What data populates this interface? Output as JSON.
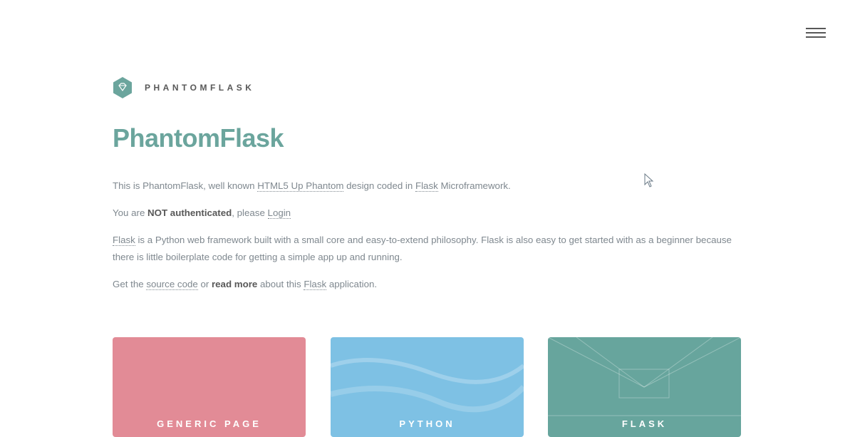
{
  "header": {
    "menu_icon": "hamburger-menu-icon"
  },
  "logo": {
    "icon": "gem-hexagon-icon",
    "text": "PHANTOMFLASK",
    "color": "#6ba59d"
  },
  "main": {
    "title": "PhantomFlask",
    "intro": {
      "t1": "This is PhantomFlask, well known ",
      "link1": "HTML5 Up Phantom",
      "t2": " design coded in ",
      "link2": "Flask",
      "t3": " Microframework."
    },
    "auth": {
      "t1": "You are ",
      "strong": "NOT authenticated",
      "t2": ", please ",
      "link": "Login"
    },
    "flask_desc": {
      "link": "Flask",
      "t1": " is a Python web framework built with a small core and easy-to-extend philosophy. Flask is also easy to get started with as a beginner because there is little boilerplate code for getting a simple app up and running."
    },
    "source": {
      "t1": "Get the ",
      "link1": "source code",
      "t2": " or ",
      "link2": "read more",
      "t3": " about this ",
      "link3": "Flask",
      "t4": " application."
    }
  },
  "tiles": [
    {
      "label": "GENERIC PAGE",
      "color": "#e28b96"
    },
    {
      "label": "PYTHON",
      "color": "#7ec1e4"
    },
    {
      "label": "FLASK",
      "color": "#67a59d"
    }
  ],
  "colors": {
    "accent": "#6ba59d",
    "text": "#7f888f",
    "heading": "#585858"
  }
}
